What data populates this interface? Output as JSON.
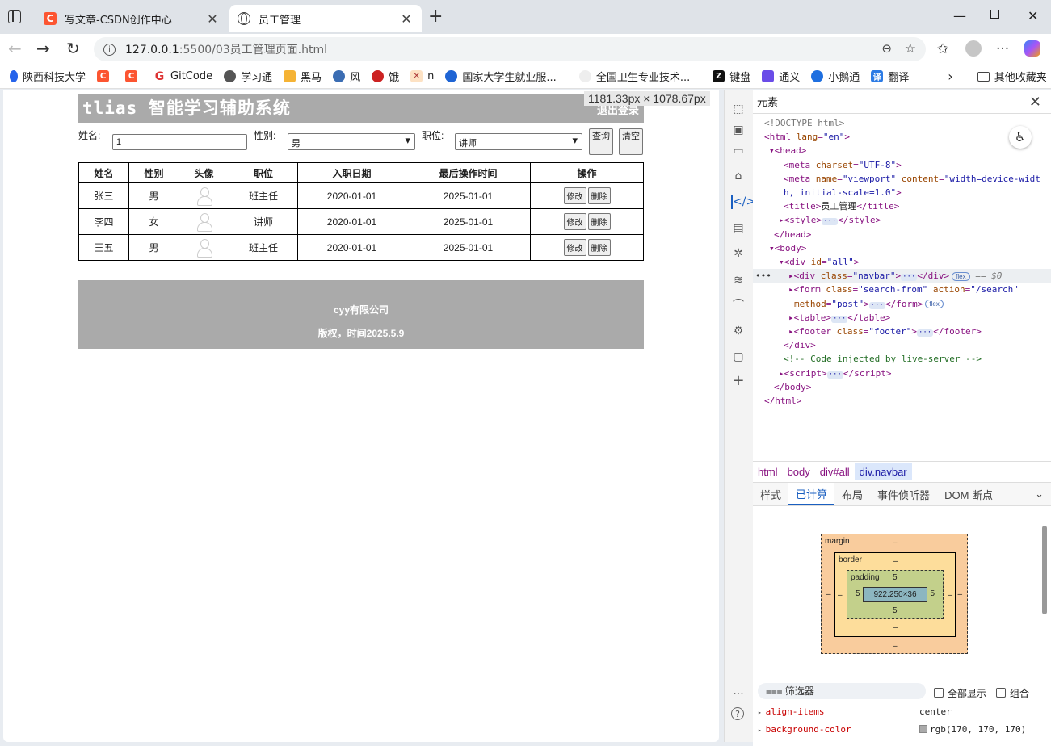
{
  "browser": {
    "tabs": [
      {
        "title": "写文章-CSDN创作中心",
        "active": false
      },
      {
        "title": "员工管理",
        "active": true
      }
    ],
    "url_host": "127.0.0.1",
    "url_path": ":5500/03员工管理页面.html",
    "bookmarks": [
      "陕西科技大学",
      "GitCode",
      "学习通",
      "黑马",
      "风",
      "饿",
      "n",
      "国家大学生就业服...",
      "全国卫生专业技术...",
      "键盘",
      "通义",
      "小鹅通",
      "翻译"
    ],
    "other_bookmarks": "其他收藏夹"
  },
  "page": {
    "brand": "tlias 智能学习辅助系统",
    "logout": "退出登录",
    "size_tooltip": "1181.33px × 1078.67px",
    "form": {
      "name_label": "姓名:",
      "name_value": "1",
      "gender_label": "性别:",
      "gender_value": "男",
      "job_label": "职位:",
      "job_value": "讲师",
      "query_button": "查询",
      "clear_button": "清空"
    },
    "table": {
      "headers": [
        "姓名",
        "性别",
        "头像",
        "职位",
        "入职日期",
        "最后操作时间",
        "操作"
      ],
      "rows": [
        {
          "name": "张三",
          "gender": "男",
          "job": "班主任",
          "entry": "2020-01-01",
          "updated": "2025-01-01"
        },
        {
          "name": "李四",
          "gender": "女",
          "job": "讲师",
          "entry": "2020-01-01",
          "updated": "2025-01-01"
        },
        {
          "name": "王五",
          "gender": "男",
          "job": "班主任",
          "entry": "2020-01-01",
          "updated": "2025-01-01"
        }
      ],
      "edit_label": "修改",
      "delete_label": "删除"
    },
    "footer": {
      "company": "cyy有限公司",
      "copyright": "版权，时间2025.5.9"
    }
  },
  "devtools": {
    "title": "元素",
    "breadcrumbs": [
      "html",
      "body",
      "div#all",
      "div.navbar"
    ],
    "panel_tabs": [
      "样式",
      "已计算",
      "布局",
      "事件侦听器",
      "DOM 断点"
    ],
    "active_panel_tab": "已计算",
    "box_model": {
      "margin_label": "margin",
      "border_label": "border",
      "padding_label": "padding",
      "dash": "–",
      "padding": "5",
      "content": "922.250×36"
    },
    "filter_placeholder": "筛选器",
    "show_all": "全部显示",
    "group": "组合",
    "props": [
      {
        "name": "align-items",
        "value": "center"
      },
      {
        "name": "background-color",
        "value": "rgb(170, 170, 170)",
        "swatch": "#aaaaaa"
      }
    ]
  }
}
